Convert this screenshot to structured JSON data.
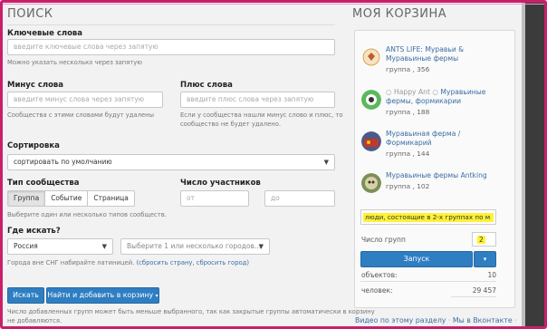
{
  "search": {
    "title": "ПОИСК",
    "keywords": {
      "label": "Ключевые слова",
      "placeholder": "введите ключевые слова через запятую",
      "hint": "Можно указать несколько через запятую"
    },
    "minus": {
      "label": "Минус слова",
      "placeholder": "введите минус слова через запятую",
      "hint": "Сообщества с этими словами будут удалены"
    },
    "plus": {
      "label": "Плюс слова",
      "placeholder": "введите плюс слова через запятую",
      "hint_line1": "Если у сообщества нашли минус слово и плюс, то",
      "hint_line2": "сообщество не будет удалено."
    },
    "sort": {
      "label": "Сортировка",
      "value": "сортировать по умолчанию"
    },
    "community_type": {
      "label": "Тип сообщества",
      "options": [
        "Группа",
        "Событие",
        "Страница"
      ],
      "selected": "Группа",
      "hint": "Выберите один или несколько типов сообществ."
    },
    "members": {
      "label": "Число участников",
      "from_placeholder": "от",
      "to_placeholder": "до"
    },
    "where": {
      "label": "Где искать?",
      "country": "Россия",
      "city_placeholder": "Выберите 1 или несколько городов...",
      "hint": "Города вне СНГ набирайте латиницей.",
      "reset_link": "(сбросить страну, сбросить город)"
    },
    "buttons": {
      "search": "Искать",
      "find_add": "Найти и добавить в корзину"
    },
    "footer_hint_line1": "Число добавленных групп может быть меньше выбранного, так как закрытые группы автоматически в корзину",
    "footer_hint_line2": "не добавляются."
  },
  "cart": {
    "title": "МОЯ КОРЗИНА",
    "items": [
      {
        "name": "ANTS LIFE: Муравьи & Муравьиные фермы",
        "meta": "группа , 356",
        "icon": "ants-life-logo"
      },
      {
        "name": "Happy Ant ○ Муравьиные фермы, формикарии",
        "meta": "группа , 188",
        "icon": "happy-ant-logo"
      },
      {
        "name": "Муравьиная ферма / Формикарий",
        "meta": "группа , 144",
        "icon": "ant-farm-avatar"
      },
      {
        "name": "Муравьиные фермы Antking",
        "meta": "группа , 102",
        "icon": "antking-avatar"
      }
    ],
    "items_display": [
      {
        "line1": "ANTS LIFE: Муравьи &",
        "line2": "Муравьиные фермы"
      },
      {
        "prefix": "○ Happy Ant ○",
        "line1": "Муравьиные",
        "line2": "фермы, формикарии"
      },
      {
        "line1": "Муравьиная ферма /",
        "line2": "Формикарий"
      },
      {
        "line1": "Муравьиные фермы Antking",
        "line2": ""
      }
    ],
    "text_field": "люди, состоящие в 2-х группах по м",
    "groups_count_label": "Число групп",
    "groups_count_value": "2",
    "submit": "Запуск",
    "objects_label": "объектов:",
    "objects_value": "10",
    "people_label": "человек:",
    "people_value": "29 457"
  },
  "footer": {
    "video_link": "Видео по этому разделу",
    "separator": "·",
    "vk_link": "Мы в Вконтакте",
    "dots": "·"
  },
  "colors": {
    "accent": "#2f7ec2",
    "frame": "#c91f6a",
    "highlight": "#fff236",
    "link": "#3a6ea5"
  }
}
